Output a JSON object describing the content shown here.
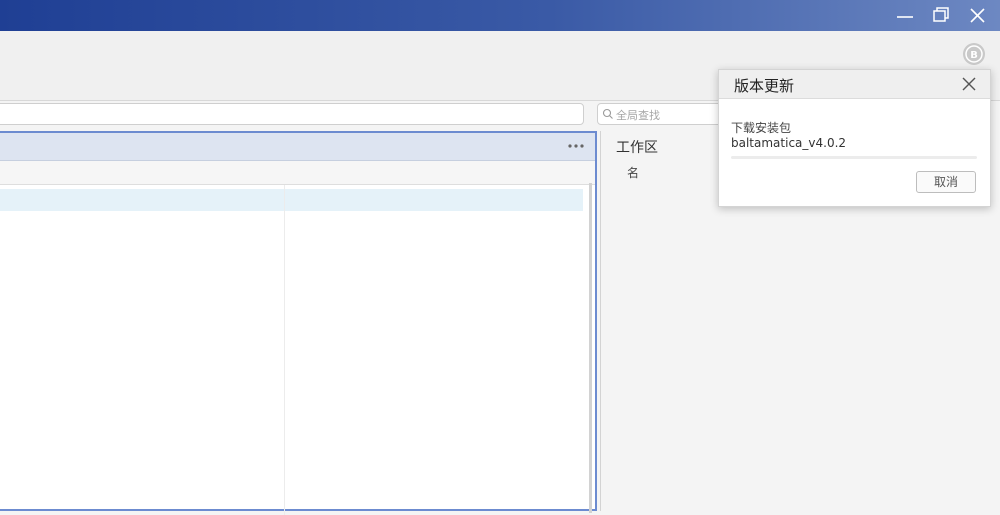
{
  "search": {
    "placeholder": "全局查找",
    "icon": "search-icon"
  },
  "workspace": {
    "title": "工作区",
    "column_name": "名"
  },
  "main_panel": {
    "more_icon": "more-icon"
  },
  "window_controls": {
    "minimize_icon": "minimize-icon",
    "restore_icon": "restore-icon",
    "close_icon": "close-icon"
  },
  "update_dialog": {
    "title": "版本更新",
    "status_label": "下载安装包",
    "file_name": "baltamatica_v4.0.2",
    "progress": 0,
    "cancel_label": "取消",
    "accent_color": "#4a7bd0"
  },
  "colors": {
    "titlebar_start": "#1f3f94",
    "titlebar_end": "#6d88c2",
    "panel_border": "#6c8bd0",
    "selected_row": "#e5f2f9"
  }
}
